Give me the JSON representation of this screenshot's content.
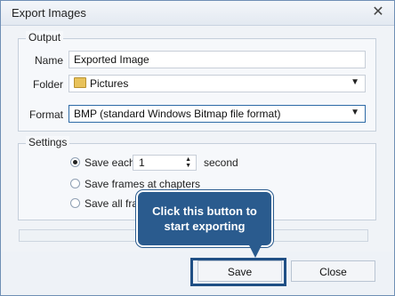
{
  "window": {
    "title": "Export Images",
    "close_glyph": "✕"
  },
  "output": {
    "label": "Output",
    "name_label": "Name",
    "name_value": "Exported Image",
    "folder_label": "Folder",
    "folder_value": "Pictures",
    "format_label": "Format",
    "format_value": "BMP (standard Windows Bitmap file format)"
  },
  "settings": {
    "label": "Settings",
    "save_each_label": "Save each",
    "save_each_value": "1",
    "save_each_unit": "second",
    "frames_at_chapters_label": "Save frames at chapters",
    "all_frames_label": "Save all fra"
  },
  "callout": {
    "line1": "Click this button to",
    "line2": "start exporting"
  },
  "buttons": {
    "save": "Save",
    "close": "Close"
  },
  "icons": {
    "folder": "folder-icon",
    "dropdown": "chevron-down-icon"
  },
  "colors": {
    "callout": "#2a5b8e",
    "highlight": "#1f4f85"
  }
}
